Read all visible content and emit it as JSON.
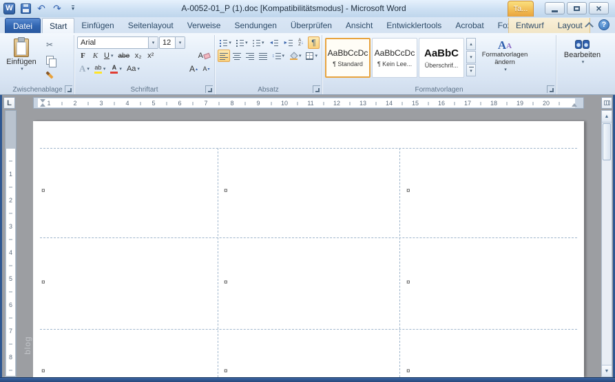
{
  "window": {
    "title": "A-0052-01_P (1).doc [Kompatibilitätsmodus] - Microsoft Word",
    "logo_letter": "W",
    "contextual_badge": "Ta..."
  },
  "quick_access": {
    "icons": [
      "word-logo",
      "save",
      "undo",
      "redo",
      "customize-quick-access"
    ]
  },
  "ribbon": {
    "file_tab": "Datei",
    "help_label": "?",
    "tabs": [
      {
        "label": "Start",
        "active": true
      },
      {
        "label": "Einfügen"
      },
      {
        "label": "Seitenlayout"
      },
      {
        "label": "Verweise"
      },
      {
        "label": "Sendungen"
      },
      {
        "label": "Überprüfen"
      },
      {
        "label": "Ansicht"
      },
      {
        "label": "Entwicklertools"
      },
      {
        "label": "Acrobat"
      },
      {
        "label": "Foxit Reader PDF"
      }
    ],
    "contextual_tabs": [
      "Entwurf",
      "Layout"
    ],
    "groups": {
      "clipboard": {
        "label": "Zwischenablage",
        "paste_label": "Einfügen"
      },
      "font": {
        "label": "Schriftart",
        "font_name": "Arial",
        "font_size": "12",
        "buttons": {
          "bold": "F",
          "italic": "K",
          "underline": "U",
          "strikethrough": "abe",
          "subscript": "x₂",
          "superscript": "x²",
          "clear_format": "A",
          "text_effects": "A",
          "highlight": "ab",
          "font_color": "A",
          "change_case": "Aa",
          "grow": "A",
          "shrink": "A"
        }
      },
      "paragraph": {
        "label": "Absatz",
        "sort_top": "A",
        "sort_bottom": "Z",
        "pilcrow": "¶"
      },
      "styles": {
        "label": "Formatvorlagen",
        "change_button": "Formatvorlagen ändern",
        "items": [
          {
            "preview": "AaBbCcDc",
            "name": "¶ Standard",
            "selected": true
          },
          {
            "preview": "AaBbCcDc",
            "name": "¶ Kein Lee..."
          },
          {
            "preview": "AaBbC",
            "name": "Überschrif..."
          }
        ]
      },
      "editing": {
        "label": "Bearbeiten"
      }
    }
  },
  "ruler": {
    "tab_selector": "L",
    "horizontal": [
      1,
      2,
      3,
      4,
      5,
      6,
      7,
      8,
      9,
      10,
      11,
      12,
      13,
      14,
      15,
      16,
      17,
      18,
      19,
      20
    ],
    "vertical": [
      1,
      2,
      3,
      4,
      5,
      6,
      7,
      8
    ]
  },
  "document": {
    "table": {
      "rows": 3,
      "cols": 3,
      "cell_mark": "¤"
    },
    "watermark": "blog"
  },
  "colors": {
    "highlight_orange": "#f9d07c",
    "file_tab_blue": "#3166b2",
    "contextual_badge_orange": "#edb04e",
    "status_bar_blue": "#27497c",
    "workspace_gray": "#9c9ea2",
    "page_background": "#ffffff"
  }
}
